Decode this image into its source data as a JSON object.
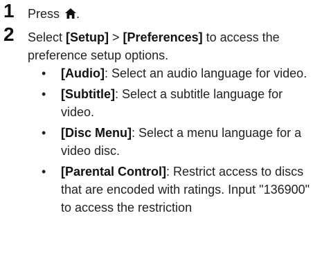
{
  "steps": [
    {
      "number": "1",
      "text_before": "Press ",
      "icon": "home-icon",
      "text_after": "."
    },
    {
      "number": "2",
      "text_before": "Select ",
      "bold_1": "[Setup]",
      "separator": " > ",
      "bold_2": "[Preferences]",
      "text_after": " to access the preference setup options."
    }
  ],
  "bullets": [
    {
      "label": "[Audio]",
      "text": ": Select an audio language for video."
    },
    {
      "label": "[Subtitle]",
      "text": ": Select a subtitle language for video."
    },
    {
      "label": "[Disc Menu]",
      "text": ": Select a menu language for a video disc."
    },
    {
      "label": "[Parental Control]",
      "text": ": Restrict access to discs that are encoded with ratings. Input \"136900\" to access the restriction"
    }
  ],
  "bullet_symbol": "•"
}
